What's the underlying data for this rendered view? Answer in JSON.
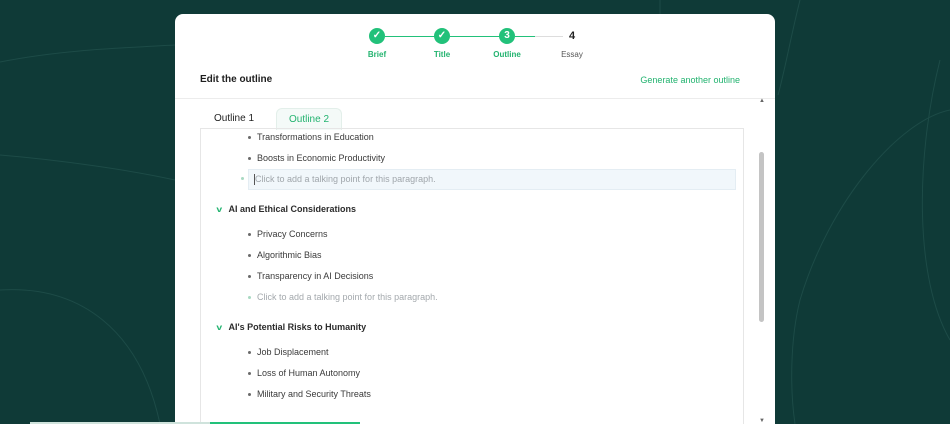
{
  "stepper": {
    "steps": [
      {
        "label": "Brief",
        "marker": "✓",
        "state": "done"
      },
      {
        "label": "Title",
        "marker": "✓",
        "state": "done"
      },
      {
        "label": "Outline",
        "marker": "3",
        "state": "current"
      },
      {
        "label": "Essay",
        "marker": "4",
        "state": "pending"
      }
    ]
  },
  "header": {
    "title": "Edit the outline",
    "generate_link": "Generate another outline"
  },
  "tabs": [
    {
      "label": "Outline 1",
      "active": false
    },
    {
      "label": "Outline 2",
      "active": true
    }
  ],
  "outline": {
    "top_items": [
      "Transformations in Education",
      "Boosts in Economic Productivity"
    ],
    "add_placeholder": "Click to add a talking point for this paragraph.",
    "sections": [
      {
        "title": "AI and Ethical Considerations",
        "items": [
          "Privacy Concerns",
          "Algorithmic Bias",
          "Transparency in AI Decisions"
        ],
        "add_placeholder": "Click to add a talking point for this paragraph."
      },
      {
        "title": "AI's Potential Risks to Humanity",
        "items": [
          "Job Displacement",
          "Loss of Human Autonomy",
          "Military and Security Threats"
        ]
      }
    ]
  },
  "colors": {
    "accent": "#22c17a",
    "background": "#0f3a37"
  },
  "icons": {
    "check": "check-icon",
    "chevron": "chevron-down-icon",
    "scroll_up": "scroll-up-arrow-icon",
    "scroll_down": "scroll-down-arrow-icon"
  }
}
